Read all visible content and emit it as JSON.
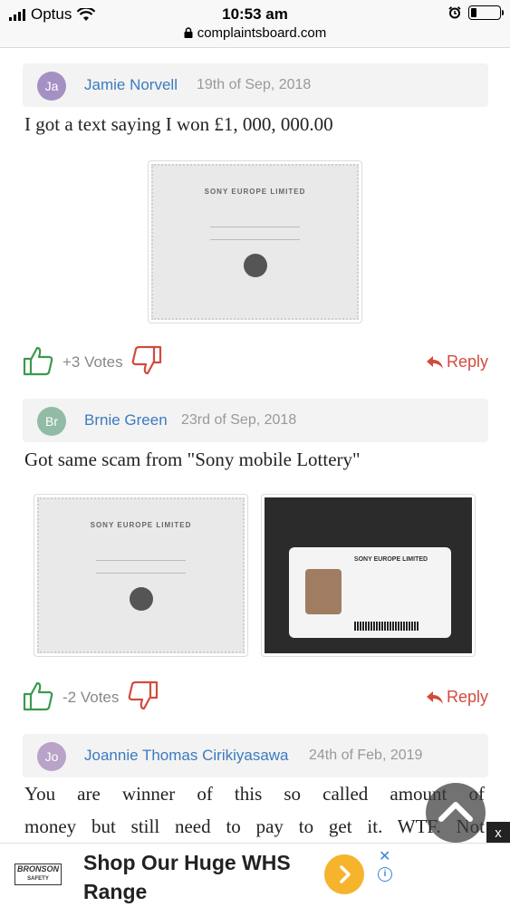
{
  "status_bar": {
    "carrier": "Optus",
    "time": "10:53 am",
    "url": "complaintsboard.com"
  },
  "colors": {
    "author_link": "#3b7bbf",
    "reply": "#d24b3e",
    "vote_up": "#3a9a4d",
    "vote_down": "#d24b3e",
    "ad_button": "#f6b42c"
  },
  "comments": [
    {
      "avatar_initials": "Ja",
      "avatar_color": "#a590c4",
      "author": "Jamie Norvell",
      "date": "19th of Sep, 2018",
      "text": "I got a text saying I won £1, 000, 000.00",
      "images": [
        "certificate-image"
      ],
      "votes": "+3 Votes",
      "reply_label": "Reply"
    },
    {
      "avatar_initials": "Br",
      "avatar_color": "#92bba6",
      "author": "Brnie Green",
      "date": "23rd of Sep, 2018",
      "text": "Got same scam from \"Sony mobile Lottery\"",
      "images": [
        "certificate-image",
        "id-card-image"
      ],
      "votes": "-2 Votes",
      "reply_label": "Reply"
    },
    {
      "avatar_initials": "Jo",
      "avatar_color": "#b9a3c9",
      "author": "Joannie Thomas Cirikiyasawa",
      "date": "24th of Feb, 2019",
      "text_line1": "You are winner of this so called amount of",
      "text_line2": "money but still need to pay to get it. WTF. Not"
    }
  ],
  "ad": {
    "brand": "BRONSON",
    "brand_sub": "SAFETY",
    "title": "Shop Our Huge WHS Range",
    "close_label": "x"
  }
}
